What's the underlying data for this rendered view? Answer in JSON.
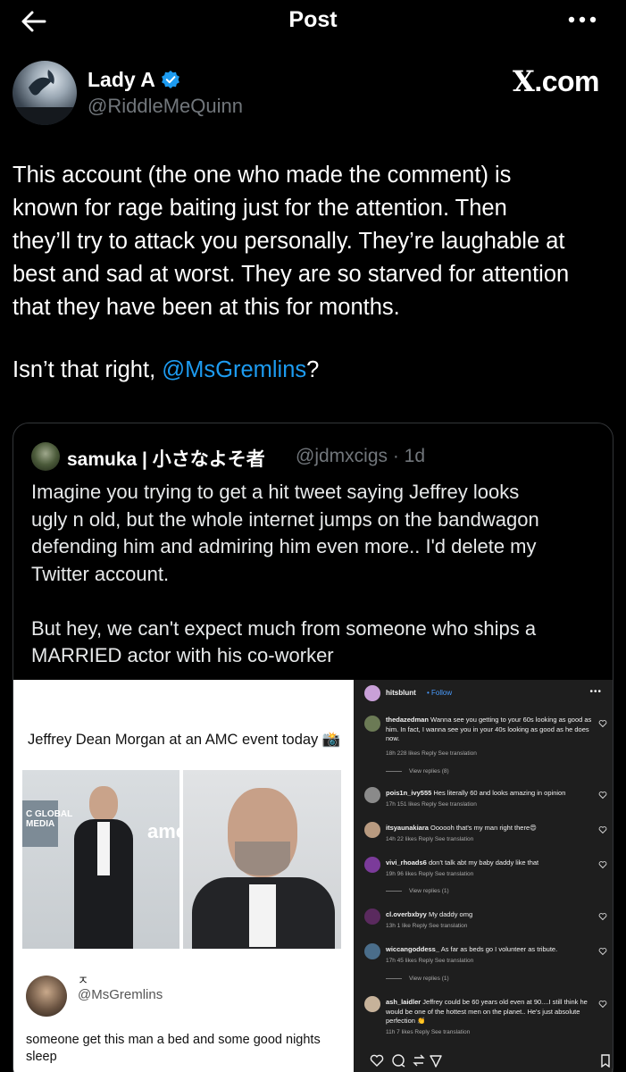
{
  "header": {
    "title": "Post"
  },
  "author": {
    "name": "Lady A",
    "handle": "@RiddleMeQuinn"
  },
  "watermark": {
    "x": "X",
    "rest": ".com"
  },
  "post": {
    "lines": "This account (the one who made the comment) is\nknown for rage baiting just for the attention. Then\nthey’ll try to attack you personally. They’re laughable at\nbest and sad at worst. They are so starved for attention\nthat they have been at this for months.",
    "closing_prefix": "Isn’t that right, ",
    "mention": "@MsGremlins",
    "closing_suffix": "?"
  },
  "quote": {
    "name": "samuka | 小さなよそ者",
    "handle_time": "@jdmxcigs · 1d",
    "text": "Imagine you trying to get a hit tweet saying Jeffrey looks\nugly n old, but the whole internet jumps on the bandwagon\ndefending him and admiring him even more.. I'd delete my\nTwitter account.\n\nBut hey, we can't expect much from someone who ships a\nMARRIED actor with his co-worker"
  },
  "media": {
    "caption": "Jeffrey Dean Morgan at an AMC event today 📸",
    "banner_1": "C GLOBAL\nMEDIA",
    "banner_2": "amc",
    "gremlins_name": "ㅈ",
    "gremlins_handle": "@MsGremlins",
    "gremlins_text": "someone get this man a bed and some good nights sleep"
  },
  "comments_panel": {
    "top_user": "hitsblunt",
    "follow": "• Follow",
    "comments": [
      {
        "user": "thedazedman",
        "text": "Wanna see you getting to your 60s looking as good as him. In fact, I wanna see you in your 40s looking as good as he does now.",
        "meta": "18h   228 likes   Reply   See translation",
        "replies": "View replies (8)"
      },
      {
        "user": "pois1n_ivy555",
        "text": "Hes literally 60 and looks amazing in opinion",
        "meta": "17h   151 likes   Reply   See translation",
        "replies": ""
      },
      {
        "user": "itsyaunakiara",
        "text": "Oooooh that's my man right there😍",
        "meta": "14h   22 likes   Reply   See translation",
        "replies": ""
      },
      {
        "user": "vivi_rhoads6",
        "text": "don't talk abt my baby daddy like that",
        "meta": "19h   96 likes   Reply   See translation",
        "replies": "View replies (1)"
      },
      {
        "user": "cl.overbxbyy",
        "text": "My daddy omg",
        "meta": "13h   1 like   Reply   See translation",
        "replies": ""
      },
      {
        "user": "wiccangoddess_",
        "text": "As far as beds go I volunteer as tribute.",
        "meta": "17h   45 likes   Reply   See translation",
        "replies": "View replies (1)"
      },
      {
        "user": "ash_laidler",
        "text": "Jeffrey could be 60 years old even at 90....I still think he would be one of the hottest men on the planet.. He's just absolute perfection 👏",
        "meta": "11h   7 likes   Reply   See translation",
        "replies": ""
      }
    ]
  },
  "colors": {
    "accent": "#1d9bf0",
    "verified": "#1d9bf0",
    "background": "#000000",
    "text": "#e7e9ea",
    "muted": "#71767b"
  },
  "icons": [
    "back-arrow-icon",
    "more-horizontal-icon",
    "verified-badge-icon",
    "heart-icon",
    "comment-icon",
    "share-icon",
    "send-icon",
    "bookmark-icon"
  ]
}
